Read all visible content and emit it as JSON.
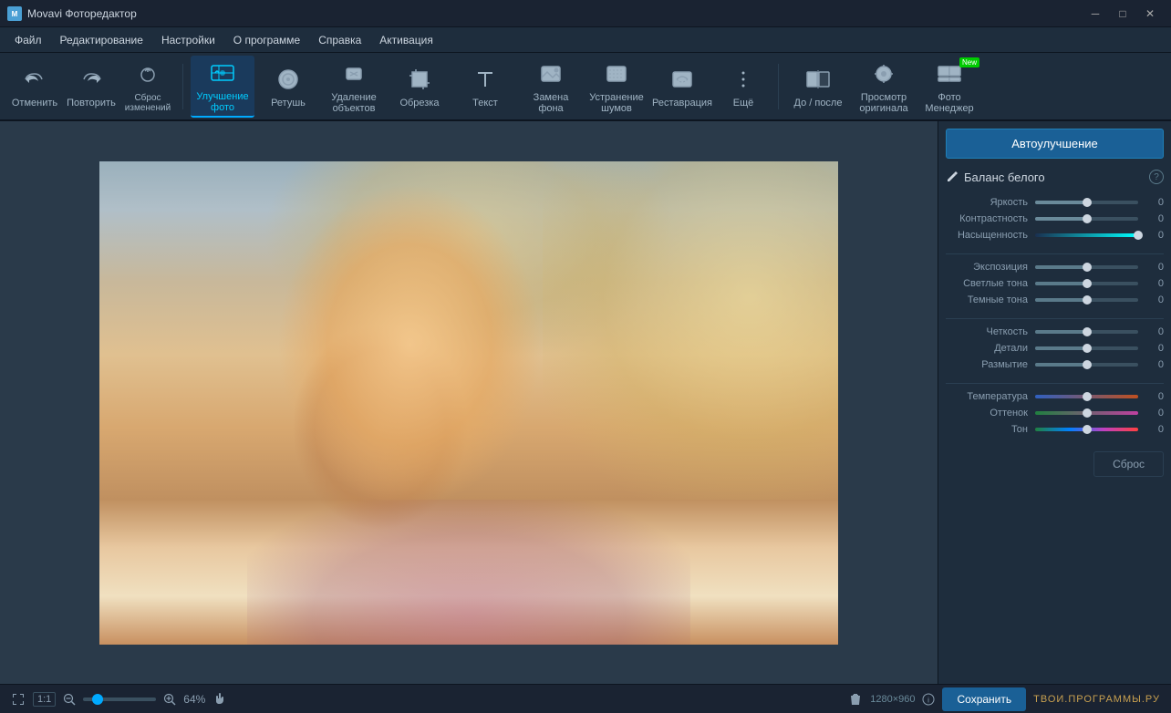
{
  "app": {
    "title": "Movavi Фоторедактор",
    "icon": "M"
  },
  "titlebar": {
    "minimize": "─",
    "maximize": "□",
    "close": "✕"
  },
  "menu": {
    "items": [
      "Файл",
      "Редактирование",
      "Настройки",
      "О программе",
      "Справка",
      "Активация"
    ]
  },
  "toolbar": {
    "undo_label": "Отменить",
    "redo_label": "Повторить",
    "reset_label": "Сброс изменений",
    "enhance_label": "Улучшение фото",
    "retouch_label": "Ретушь",
    "remove_label": "Удаление объектов",
    "crop_label": "Обрезка",
    "text_label": "Текст",
    "replace_bg_label": "Замена фона",
    "denoise_label": "Устранение шумов",
    "restore_label": "Реставрация",
    "more_label": "Ещё",
    "before_after_label": "До / после",
    "view_orig_label": "Просмотр оригинала",
    "photo_manager_label": "Фото Менеджер",
    "new_badge": "New"
  },
  "panel": {
    "auto_enhance": "Автоулучшение",
    "white_balance": "Баланс белого",
    "help": "?",
    "sliders": [
      {
        "label": "Яркость",
        "value": "0",
        "pct": 50,
        "type": "gray"
      },
      {
        "label": "Контрастность",
        "value": "0",
        "pct": 50,
        "type": "gray"
      },
      {
        "label": "Насыщенность",
        "value": "0",
        "pct": 100,
        "type": "cyan"
      }
    ],
    "sliders2": [
      {
        "label": "Экспозиция",
        "value": "0",
        "pct": 50,
        "type": "gray"
      },
      {
        "label": "Светлые тона",
        "value": "0",
        "pct": 50,
        "type": "gray"
      },
      {
        "label": "Темные тона",
        "value": "0",
        "pct": 50,
        "type": "gray"
      }
    ],
    "sliders3": [
      {
        "label": "Четкость",
        "value": "0",
        "pct": 50,
        "type": "gray"
      },
      {
        "label": "Детали",
        "value": "0",
        "pct": 50,
        "type": "gray"
      },
      {
        "label": "Размытие",
        "value": "0",
        "pct": 50,
        "type": "gray"
      }
    ],
    "sliders4": [
      {
        "label": "Температура",
        "value": "0",
        "pct": 50,
        "type": "temp"
      },
      {
        "label": "Оттенок",
        "value": "0",
        "pct": 50,
        "type": "tint"
      },
      {
        "label": "Тон",
        "value": "0",
        "pct": 50,
        "type": "tone"
      }
    ],
    "reset_btn": "Сброс"
  },
  "statusbar": {
    "fit_label": "1:1",
    "zoom_pct": "64%",
    "img_size": "1280×960",
    "save_btn": "Сохранить",
    "watermark": "Твои.Программы.РУ"
  }
}
